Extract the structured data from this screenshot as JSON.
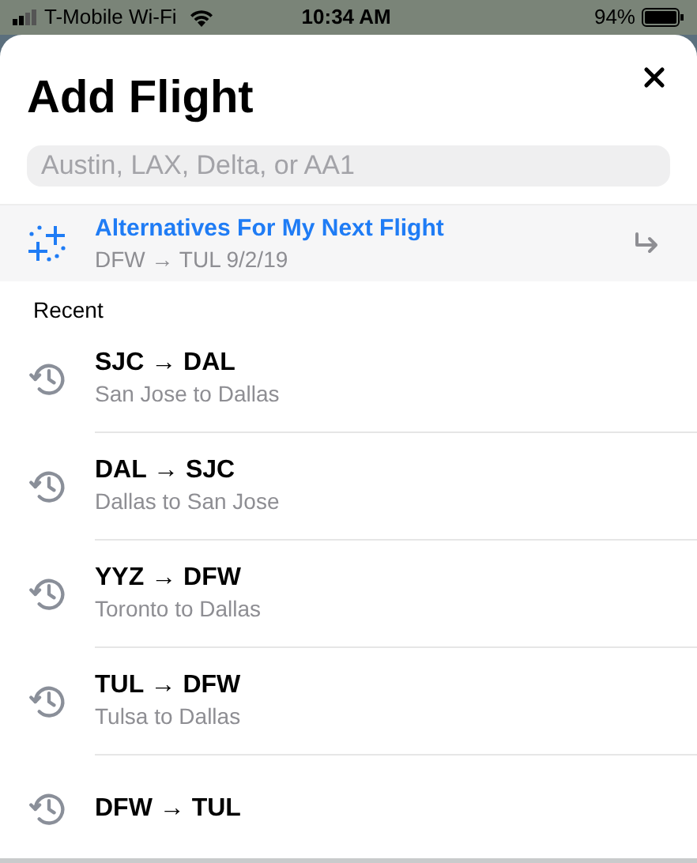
{
  "status_bar": {
    "carrier": "T-Mobile Wi-Fi",
    "time": "10:34 AM",
    "battery": "94%"
  },
  "title": "Add Flight",
  "search": {
    "placeholder": "Austin, LAX, Delta, or AA1"
  },
  "suggestion": {
    "title": "Alternatives For My Next Flight",
    "subtitle": "DFW → TUL 9/2/19"
  },
  "section": "Recent",
  "recent": [
    {
      "route": "SJC → DAL",
      "cities": "San Jose to Dallas"
    },
    {
      "route": "DAL → SJC",
      "cities": "Dallas to San Jose"
    },
    {
      "route": "YYZ → DFW",
      "cities": "Toronto to Dallas"
    },
    {
      "route": "TUL → DFW",
      "cities": "Tulsa to Dallas"
    },
    {
      "route": "DFW → TUL"
    }
  ]
}
